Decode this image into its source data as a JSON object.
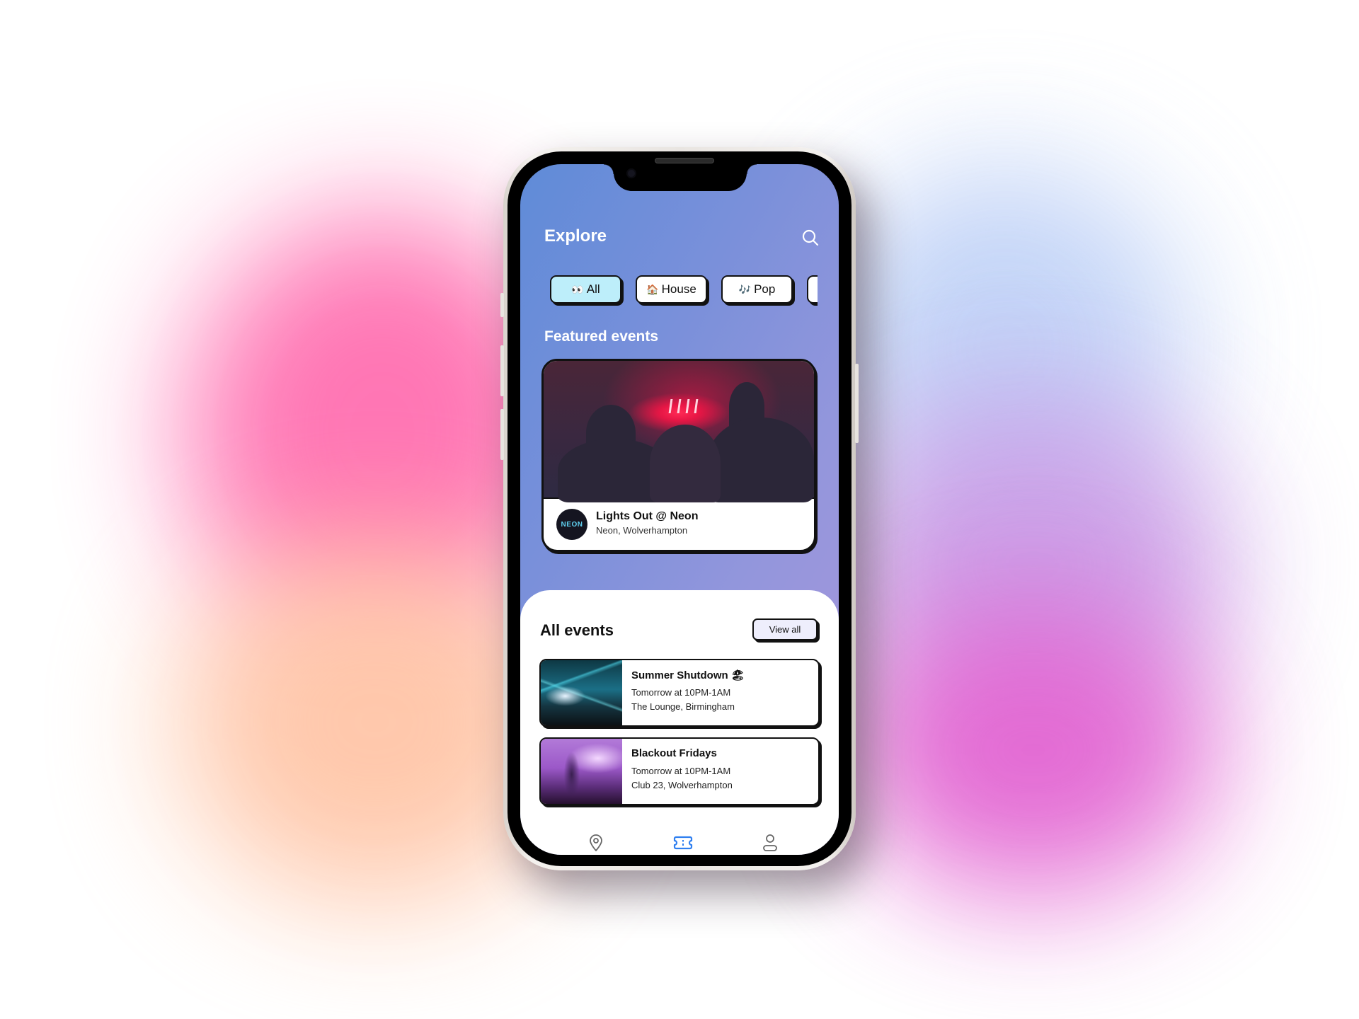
{
  "app": {
    "screen_title": "Explore",
    "search_icon": "search-icon"
  },
  "categories": [
    {
      "emoji": "👀",
      "label": "All",
      "active": true
    },
    {
      "emoji": "🏠",
      "label": "House",
      "active": false
    },
    {
      "emoji": "🎶",
      "label": "Pop",
      "active": false
    },
    {
      "emoji": "",
      "label": "",
      "active": false
    }
  ],
  "featured": {
    "section_title": "Featured events",
    "event": {
      "name": "Lights Out @ Neon",
      "location": "Neon, Wolverhampton",
      "logo_text": "NEON"
    }
  },
  "all_events": {
    "section_title": "All events",
    "view_all_label": "View all",
    "items": [
      {
        "name": "Summer Shutdown",
        "emoji": "🏖",
        "time": "Tomorrow at 10PM-1AM",
        "venue": "The Lounge, Birmingham"
      },
      {
        "name": "Blackout Fridays",
        "emoji": "",
        "time": "Tomorrow at 10PM-1AM",
        "venue": "Club 23, Wolverhampton"
      }
    ]
  },
  "bottom_nav": [
    {
      "icon": "map-pin-icon",
      "active": false
    },
    {
      "icon": "ticket-icon",
      "active": true
    },
    {
      "icon": "profile-icon",
      "active": false
    }
  ],
  "colors": {
    "accent_active_nav": "#2f7ff0",
    "chip_active_bg": "#bdeefa",
    "view_all_bg": "#eeeefc",
    "header_gradient_start": "#5f8bd8",
    "header_gradient_end": "#a997dd"
  }
}
